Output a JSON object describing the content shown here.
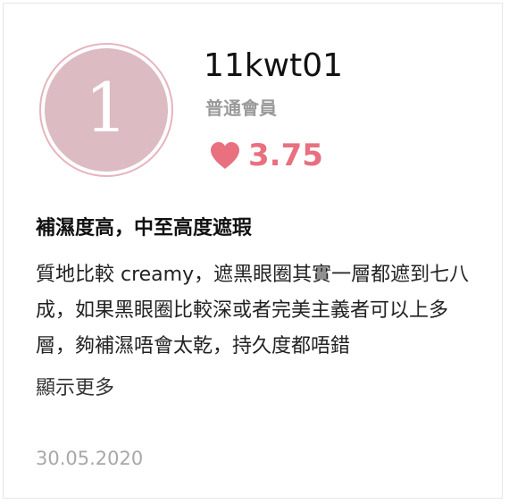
{
  "user": {
    "rank": "1",
    "username": "11kwt01",
    "level": "普通會員"
  },
  "rating": {
    "value": "3.75",
    "icon": "heart-icon",
    "color": "#e8707f"
  },
  "review": {
    "title": "補濕度高，中至高度遮瑕",
    "body": "質地比較 creamy，遮黑眼圈其實一層都遮到七八成，如果黑眼圈比較深或者完美主義者可以上多層，夠補濕唔會太乾，持久度都唔錯",
    "show_more_label": "顯示更多",
    "date": "30.05.2020"
  },
  "colors": {
    "avatar_fill": "#dcbbc2",
    "avatar_ring": "#e6b4bd"
  }
}
